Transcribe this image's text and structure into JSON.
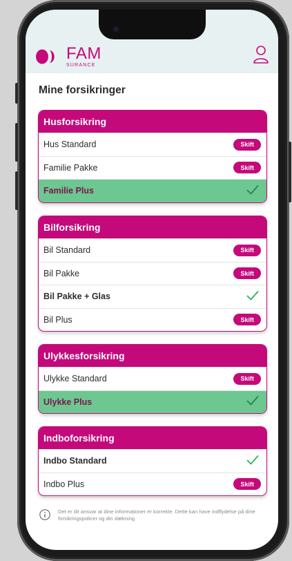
{
  "colors": {
    "brand": "#c4097a",
    "header_bg": "#e7f1f2",
    "selected_row": "#6cc790",
    "check": "#2bb35f"
  },
  "header": {
    "logo_main": "FAM",
    "logo_sub": "SURANCE",
    "user_icon": "user-icon"
  },
  "page_title": "Mine forsikringer",
  "button_label": "Skift",
  "sections": [
    {
      "title": "Husforsikring",
      "items": [
        {
          "label": "Hus Standard",
          "state": "skift"
        },
        {
          "label": "Familie Pakke",
          "state": "skift"
        },
        {
          "label": "Familie Plus",
          "state": "selected"
        }
      ]
    },
    {
      "title": "Bilforsikring",
      "items": [
        {
          "label": "Bil Standard",
          "state": "skift"
        },
        {
          "label": "Bil Pakke",
          "state": "skift"
        },
        {
          "label": "Bil Pakke + Glas",
          "state": "current"
        },
        {
          "label": "Bil Plus",
          "state": "skift"
        }
      ]
    },
    {
      "title": "Ulykkesforsikring",
      "items": [
        {
          "label": "Ulykke Standard",
          "state": "skift"
        },
        {
          "label": "Ulykke Plus",
          "state": "selected"
        }
      ]
    },
    {
      "title": "Indboforsikring",
      "items": [
        {
          "label": "Indbo Standard",
          "state": "current"
        },
        {
          "label": "Indbo Plus",
          "state": "skift"
        }
      ]
    }
  ],
  "disclaimer": "Det er dit ansvar at dine informationer er korrekte. Dette kan have indflydelse på dine forsikringspolicer og din dækning."
}
